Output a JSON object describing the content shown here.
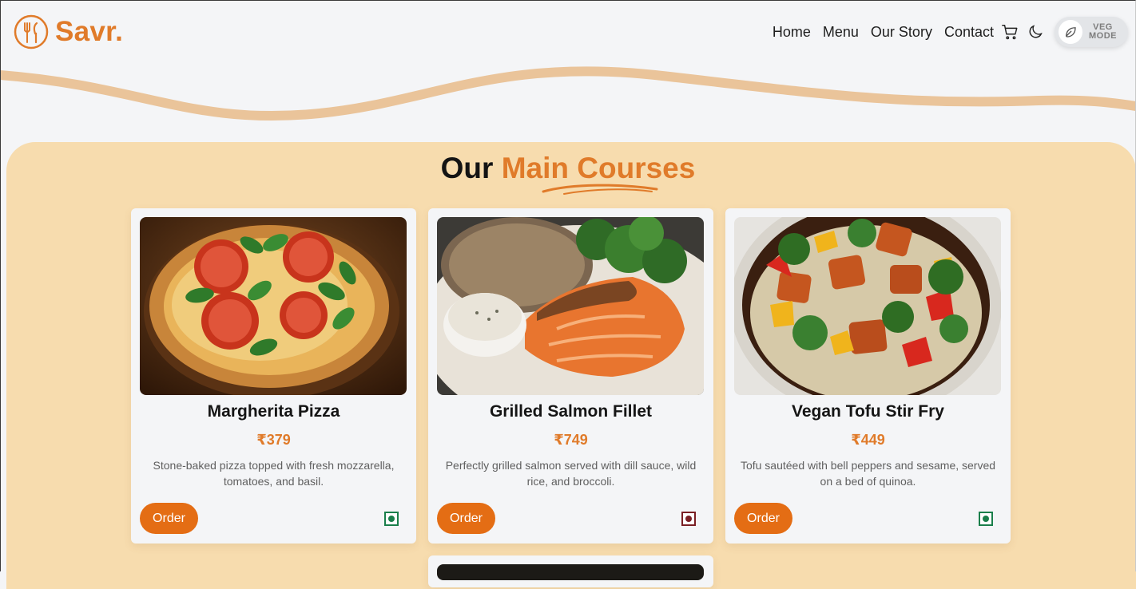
{
  "brand": {
    "name": "Savr.",
    "logo_icon": "fork-knife-icon",
    "accent": "#e07b2a"
  },
  "nav": {
    "links": [
      "Home",
      "Menu",
      "Our Story",
      "Contact"
    ],
    "cart_icon": "cart-icon",
    "theme_icon": "moon-icon",
    "veg_mode": {
      "line1": "VEG",
      "line2": "MODE",
      "icon": "leaf-icon",
      "enabled": false
    }
  },
  "section": {
    "title_plain": "Our",
    "title_accent": "Main Courses"
  },
  "dishes": [
    {
      "name": "Margherita Pizza",
      "price": "₹379",
      "description": "Stone-baked pizza topped with fresh mozzarella, tomatoes, and basil.",
      "order_label": "Order",
      "diet": "veg",
      "diet_color": "#1a7f4b"
    },
    {
      "name": "Grilled Salmon Fillet",
      "price": "₹749",
      "description": "Perfectly grilled salmon served with dill sauce, wild rice, and broccoli.",
      "order_label": "Order",
      "diet": "non-veg",
      "diet_color": "#7a1f24"
    },
    {
      "name": "Vegan Tofu Stir Fry",
      "price": "₹449",
      "description": "Tofu sautéed with bell peppers and sesame, served on a bed of quinoa.",
      "order_label": "Order",
      "diet": "veg",
      "diet_color": "#1a7f4b"
    }
  ],
  "colors": {
    "page_bg": "#f4f5f7",
    "section_bg": "#f7dcae",
    "button": "#e46d14",
    "wave": "#eac49a"
  }
}
